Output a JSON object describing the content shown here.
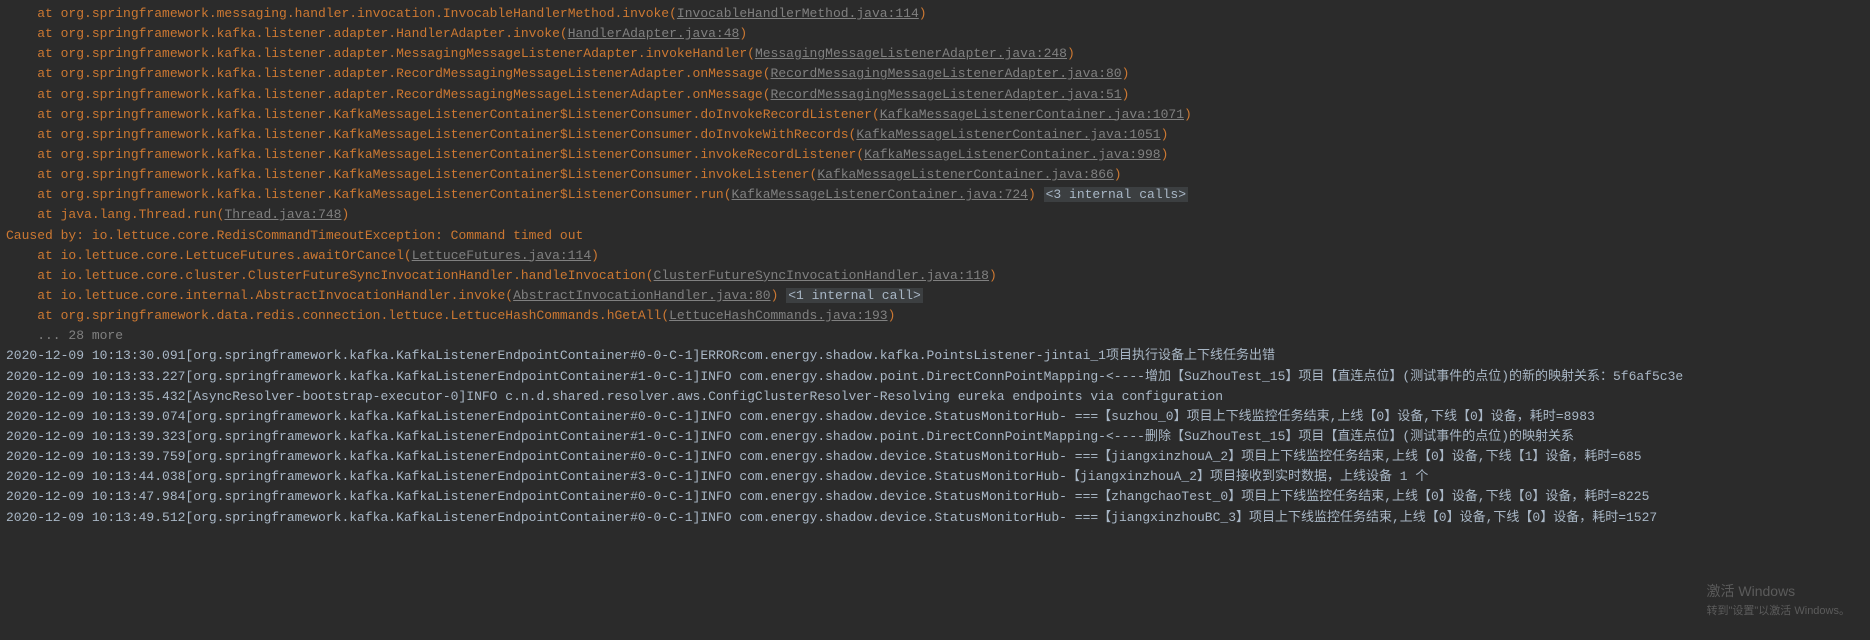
{
  "stack": [
    {
      "pkg": "org.springframework.messaging.handler.invocation.InvocableHandlerMethod.invoke",
      "src": "InvocableHandlerMethod.java:114"
    },
    {
      "pkg": "org.springframework.kafka.listener.adapter.HandlerAdapter.invoke",
      "src": "HandlerAdapter.java:48"
    },
    {
      "pkg": "org.springframework.kafka.listener.adapter.MessagingMessageListenerAdapter.invokeHandler",
      "src": "MessagingMessageListenerAdapter.java:248"
    },
    {
      "pkg": "org.springframework.kafka.listener.adapter.RecordMessagingMessageListenerAdapter.onMessage",
      "src": "RecordMessagingMessageListenerAdapter.java:80"
    },
    {
      "pkg": "org.springframework.kafka.listener.adapter.RecordMessagingMessageListenerAdapter.onMessage",
      "src": "RecordMessagingMessageListenerAdapter.java:51"
    },
    {
      "pkg": "org.springframework.kafka.listener.KafkaMessageListenerContainer$ListenerConsumer.doInvokeRecordListener",
      "src": "KafkaMessageListenerContainer.java:1071"
    },
    {
      "pkg": "org.springframework.kafka.listener.KafkaMessageListenerContainer$ListenerConsumer.doInvokeWithRecords",
      "src": "KafkaMessageListenerContainer.java:1051"
    },
    {
      "pkg": "org.springframework.kafka.listener.KafkaMessageListenerContainer$ListenerConsumer.invokeRecordListener",
      "src": "KafkaMessageListenerContainer.java:998"
    },
    {
      "pkg": "org.springframework.kafka.listener.KafkaMessageListenerContainer$ListenerConsumer.invokeListener",
      "src": "KafkaMessageListenerContainer.java:866"
    },
    {
      "pkg": "org.springframework.kafka.listener.KafkaMessageListenerContainer$ListenerConsumer.run",
      "src": "KafkaMessageListenerContainer.java:724",
      "internal": "<3 internal calls>"
    },
    {
      "pkg": "java.lang.Thread.run",
      "src": "Thread.java:748"
    }
  ],
  "caused": "Caused by: io.lettuce.core.RedisCommandTimeoutException: Command timed out",
  "stack2": [
    {
      "pkg": "io.lettuce.core.LettuceFutures.awaitOrCancel",
      "src": "LettuceFutures.java:114"
    },
    {
      "pkg": "io.lettuce.core.cluster.ClusterFutureSyncInvocationHandler.handleInvocation",
      "src": "ClusterFutureSyncInvocationHandler.java:118"
    },
    {
      "pkg": "io.lettuce.core.internal.AbstractInvocationHandler.invoke",
      "src": "AbstractInvocationHandler.java:80",
      "internal": "<1 internal call>"
    },
    {
      "pkg": "org.springframework.data.redis.connection.lettuce.LettuceHashCommands.hGetAll",
      "src": "LettuceHashCommands.java:193"
    }
  ],
  "more": "    ... 28 more",
  "logs": [
    "2020-12-09 10:13:30.091[org.springframework.kafka.KafkaListenerEndpointContainer#0-0-C-1]ERRORcom.energy.shadow.kafka.PointsListener-jintai_1项目执行设备上下线任务出错",
    "2020-12-09 10:13:33.227[org.springframework.kafka.KafkaListenerEndpointContainer#1-0-C-1]INFO com.energy.shadow.point.DirectConnPointMapping-<----增加【SuZhouTest_15】项目【直连点位】(测试事件的点位)的新的映射关系：5f6af5c3e",
    "2020-12-09 10:13:35.432[AsyncResolver-bootstrap-executor-0]INFO c.n.d.shared.resolver.aws.ConfigClusterResolver-Resolving eureka endpoints via configuration",
    "2020-12-09 10:13:39.074[org.springframework.kafka.KafkaListenerEndpointContainer#0-0-C-1]INFO com.energy.shadow.device.StatusMonitorHub- ===【suzhou_0】项目上下线监控任务结束,上线【0】设备,下线【0】设备，耗时=8983",
    "2020-12-09 10:13:39.323[org.springframework.kafka.KafkaListenerEndpointContainer#1-0-C-1]INFO com.energy.shadow.point.DirectConnPointMapping-<----删除【SuZhouTest_15】项目【直连点位】(测试事件的点位)的映射关系",
    "2020-12-09 10:13:39.759[org.springframework.kafka.KafkaListenerEndpointContainer#0-0-C-1]INFO com.energy.shadow.device.StatusMonitorHub- ===【jiangxinzhouA_2】项目上下线监控任务结束,上线【0】设备,下线【1】设备，耗时=685",
    "2020-12-09 10:13:44.038[org.springframework.kafka.KafkaListenerEndpointContainer#3-0-C-1]INFO com.energy.shadow.device.StatusMonitorHub-【jiangxinzhouA_2】项目接收到实时数据，上线设备 1 个",
    "2020-12-09 10:13:47.984[org.springframework.kafka.KafkaListenerEndpointContainer#0-0-C-1]INFO com.energy.shadow.device.StatusMonitorHub- ===【zhangchaoTest_0】项目上下线监控任务结束,上线【0】设备,下线【0】设备，耗时=8225",
    "2020-12-09 10:13:49.512[org.springframework.kafka.KafkaListenerEndpointContainer#0-0-C-1]INFO com.energy.shadow.device.StatusMonitorHub- ===【jiangxinzhouBC_3】项目上下线监控任务结束,上线【0】设备,下线【0】设备，耗时=1527"
  ],
  "watermark": {
    "line1": "激活 Windows",
    "line2": "转到\"设置\"以激活 Windows。"
  }
}
